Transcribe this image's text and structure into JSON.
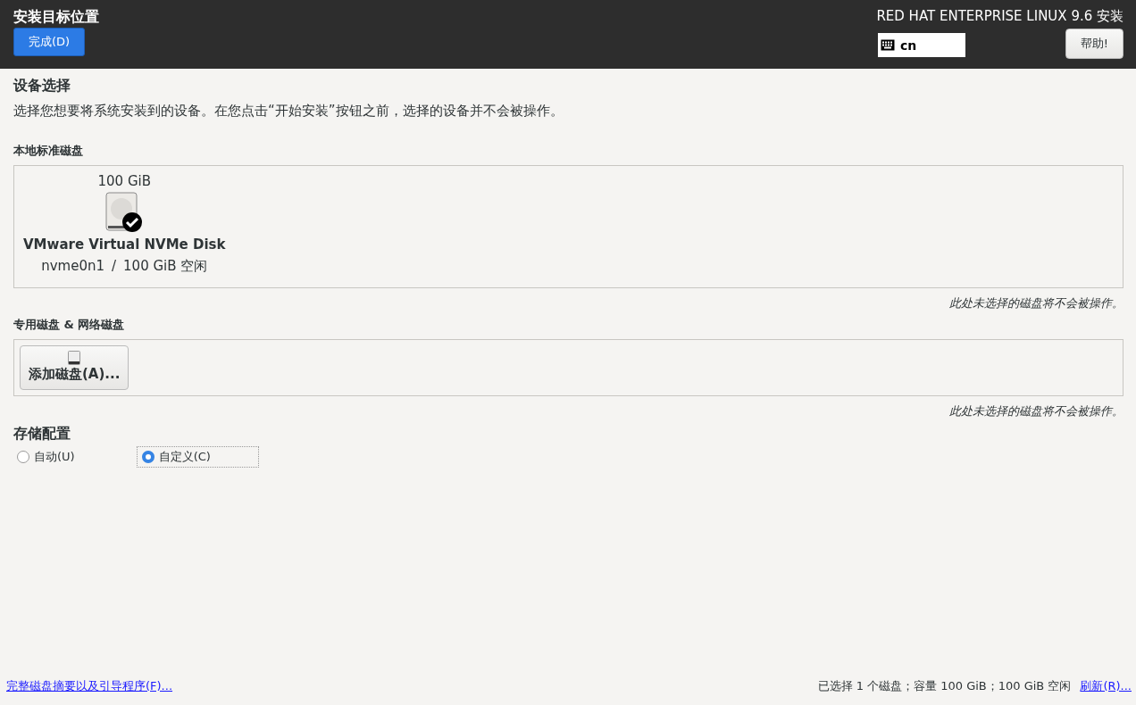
{
  "header": {
    "title": "安装目标位置",
    "done_button": "完成(D)",
    "product": "RED HAT ENTERPRISE LINUX 9.6 安装",
    "keyboard_layout": "cn",
    "help_button": "帮助!"
  },
  "device_selection": {
    "heading": "设备选择",
    "description": "选择您想要将系统安装到的设备。在您点击“开始安装”按钮之前，选择的设备并不会被操作。"
  },
  "local_disks": {
    "heading": "本地标准磁盘",
    "disks": [
      {
        "size": "100 GiB",
        "name": "VMware Virtual NVMe Disk",
        "device": "nvme0n1",
        "separator": "/",
        "free": "100 GiB 空闲",
        "selected": true
      }
    ],
    "note": "此处未选择的磁盘将不会被操作。"
  },
  "special_disks": {
    "heading": "专用磁盘 & 网络磁盘",
    "add_button": "添加磁盘(A)...",
    "note": "此处未选择的磁盘将不会被操作。"
  },
  "storage_config": {
    "heading": "存储配置",
    "options": [
      {
        "label": "自动(U)",
        "selected": false
      },
      {
        "label": "自定义(C)",
        "selected": true
      }
    ]
  },
  "footer": {
    "summary_link": "完整磁盘摘要以及引导程序(F)...",
    "status": "已选择 1 个磁盘；容量 100 GiB；100 GiB 空闲",
    "refresh_link": "刷新(R)..."
  }
}
